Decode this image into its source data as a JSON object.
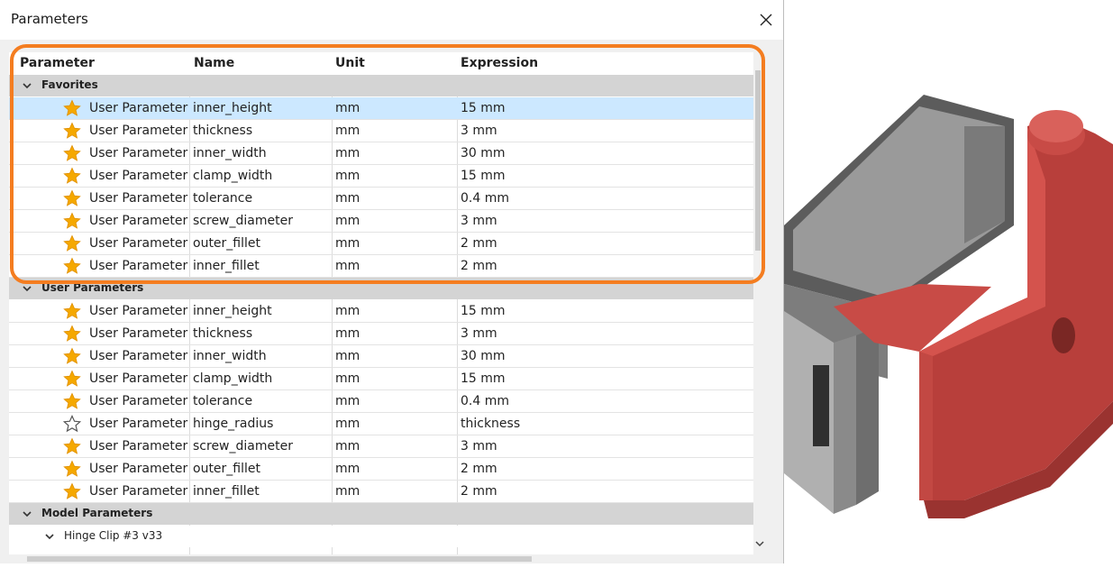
{
  "window": {
    "title": "Parameters"
  },
  "columns": {
    "parameter": "Parameter",
    "name": "Name",
    "unit": "Unit",
    "expression": "Expression"
  },
  "favorites": {
    "label": "Favorites",
    "rows": [
      {
        "type": "User Parameter",
        "name": "inner_height",
        "unit": "mm",
        "expression": "15 mm",
        "favorite": true,
        "selected": true
      },
      {
        "type": "User Parameter",
        "name": "thickness",
        "unit": "mm",
        "expression": "3 mm",
        "favorite": true
      },
      {
        "type": "User Parameter",
        "name": "inner_width",
        "unit": "mm",
        "expression": "30 mm",
        "favorite": true
      },
      {
        "type": "User Parameter",
        "name": "clamp_width",
        "unit": "mm",
        "expression": "15 mm",
        "favorite": true
      },
      {
        "type": "User Parameter",
        "name": "tolerance",
        "unit": "mm",
        "expression": "0.4 mm",
        "favorite": true
      },
      {
        "type": "User Parameter",
        "name": "screw_diameter",
        "unit": "mm",
        "expression": "3 mm",
        "favorite": true
      },
      {
        "type": "User Parameter",
        "name": "outer_fillet",
        "unit": "mm",
        "expression": "2 mm",
        "favorite": true
      },
      {
        "type": "User Parameter",
        "name": "inner_fillet",
        "unit": "mm",
        "expression": "2 mm",
        "favorite": true
      }
    ]
  },
  "user_parameters": {
    "label": "User Parameters",
    "rows": [
      {
        "type": "User Parameter",
        "name": "inner_height",
        "unit": "mm",
        "expression": "15 mm",
        "favorite": true
      },
      {
        "type": "User Parameter",
        "name": "thickness",
        "unit": "mm",
        "expression": "3 mm",
        "favorite": true
      },
      {
        "type": "User Parameter",
        "name": "inner_width",
        "unit": "mm",
        "expression": "30 mm",
        "favorite": true
      },
      {
        "type": "User Parameter",
        "name": "clamp_width",
        "unit": "mm",
        "expression": "15 mm",
        "favorite": true
      },
      {
        "type": "User Parameter",
        "name": "tolerance",
        "unit": "mm",
        "expression": "0.4 mm",
        "favorite": true
      },
      {
        "type": "User Parameter",
        "name": "hinge_radius",
        "unit": "mm",
        "expression": "thickness",
        "favorite": false
      },
      {
        "type": "User Parameter",
        "name": "screw_diameter",
        "unit": "mm",
        "expression": "3 mm",
        "favorite": true
      },
      {
        "type": "User Parameter",
        "name": "outer_fillet",
        "unit": "mm",
        "expression": "2 mm",
        "favorite": true
      },
      {
        "type": "User Parameter",
        "name": "inner_fillet",
        "unit": "mm",
        "expression": "2 mm",
        "favorite": true
      }
    ]
  },
  "model_parameters": {
    "label": "Model Parameters",
    "component": "Hinge Clip #3 v33"
  },
  "colors": {
    "highlight": "#f47d20",
    "selected_row": "#cce8ff",
    "star": "#f5a800",
    "model_body": "#c84b46",
    "model_gray": "#6a6a6a"
  },
  "icons": {
    "close": "close-icon",
    "star": "star-icon",
    "star_outline": "star-outline-icon",
    "chevron": "chevron-down-icon"
  }
}
